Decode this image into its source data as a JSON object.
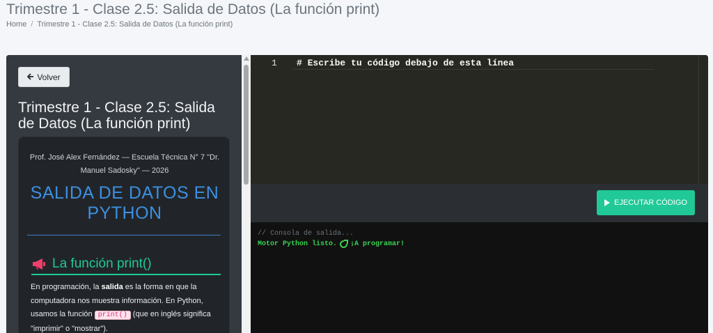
{
  "page": {
    "title": "Trimestre 1 - Clase 2.5: Salida de Datos (La función print)",
    "breadcrumb": {
      "home": "Home",
      "separator": "/",
      "current": "Trimestre 1 - Clase 2.5: Salida de Datos (La función print)"
    }
  },
  "lesson": {
    "back_label": "Volver",
    "title": "Trimestre 1 - Clase 2.5: Salida de Datos (La función print)",
    "author": "Prof. José Alex Fernández — Escuela Técnica N° 7 \"Dr. Manuel Sadosky\" — 2026",
    "big_title": "SALIDA DE DATOS EN PYTHON",
    "section_heading": "La función print()",
    "paragraph": {
      "part1": "En programación, la ",
      "bold": "salida",
      "part2": " es la forma en que la computadora nos muestra información. En Python, usamos la función ",
      "code": "print()",
      "part3": " (que en inglés significa \"imprimir\" o \"mostrar\")."
    }
  },
  "editor": {
    "line_number": "1",
    "code": "# Escribe tu código debajo de esta línea"
  },
  "toolbar": {
    "run_label": "EJECUTAR CÓDIGO"
  },
  "console": {
    "comment": "// Consola de salida...",
    "ready_text": "Motor Python listo.",
    "ready_suffix": "¡A programar!"
  },
  "colors": {
    "accent": "#20c997",
    "title_blue": "#3d8fe0",
    "console_green": "#39d353"
  },
  "icons": [
    "arrow-left-icon",
    "megaphone-icon",
    "play-icon",
    "rocket-icon"
  ]
}
